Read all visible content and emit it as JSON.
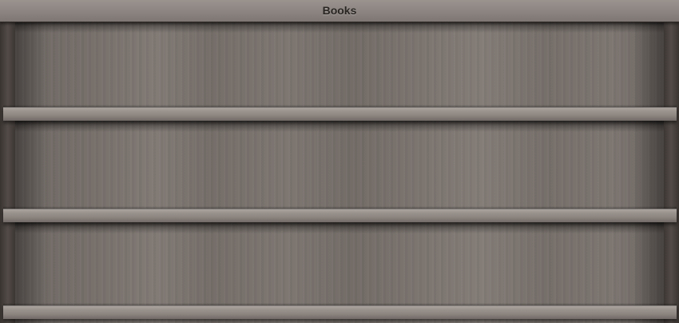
{
  "window": {
    "title": "Books"
  },
  "shelves": [
    {
      "books": []
    },
    {
      "books": []
    },
    {
      "books": []
    }
  ],
  "colors": {
    "titlebar": "#8b8480",
    "wood": "#77706b",
    "shelf": "#9a938e",
    "frame": "#3e3835",
    "title_text": "#2a2624"
  }
}
